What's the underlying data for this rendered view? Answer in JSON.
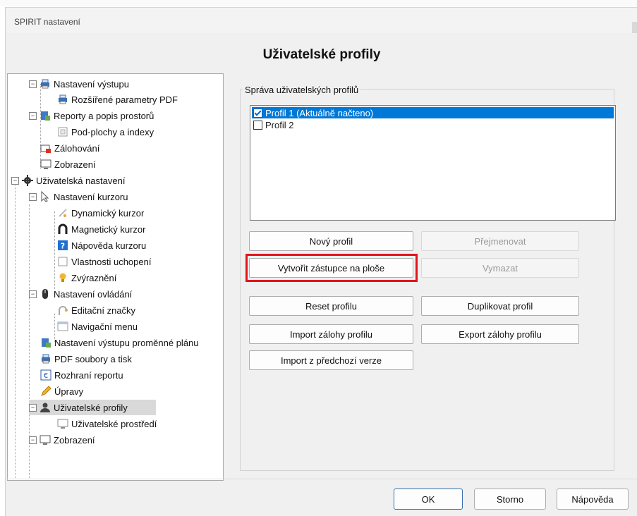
{
  "window": {
    "title": "SPIRIT nastavení",
    "page_title": "Uživatelské profily"
  },
  "tree": [
    {
      "label": "Nastavení výstupu",
      "icon": "printer-icon",
      "expander": "⊟"
    },
    {
      "label": "Rozšířené parametry PDF",
      "icon": "printer-icon"
    },
    {
      "label": "Reporty a popis prostorů",
      "icon": "report-icon",
      "expander": "⊟"
    },
    {
      "label": "Pod-plochy a indexy",
      "icon": "subarea-icon"
    },
    {
      "label": "Zálohování",
      "icon": "backup-icon"
    },
    {
      "label": "Zobrazení",
      "icon": "monitor-icon"
    },
    {
      "label": "Uživatelská nastavení",
      "icon": "gear-icon",
      "expander": "⊟"
    },
    {
      "label": "Nastavení kurzoru",
      "icon": "cursor-icon",
      "expander": "⊟"
    },
    {
      "label": "Dynamický kurzor",
      "icon": "dynamic-cursor-icon"
    },
    {
      "label": "Magnetický kurzor",
      "icon": "magnet-icon"
    },
    {
      "label": "Nápověda kurzoru",
      "icon": "help-icon"
    },
    {
      "label": "Vlastnosti uchopení",
      "icon": "snap-icon"
    },
    {
      "label": "Zvýraznění",
      "icon": "bulb-icon"
    },
    {
      "label": "Nastavení ovládání",
      "icon": "mouse-icon",
      "expander": "⊟"
    },
    {
      "label": "Editační značky",
      "icon": "edit-mark-icon"
    },
    {
      "label": "Navigační menu",
      "icon": "menu-icon"
    },
    {
      "label": "Nastavení výstupu proměnné plánu",
      "icon": "report-icon"
    },
    {
      "label": "PDF soubory a tisk",
      "icon": "printer-icon"
    },
    {
      "label": "Rozhraní reportu",
      "icon": "report-interface-icon"
    },
    {
      "label": "Úpravy",
      "icon": "pencil-icon"
    },
    {
      "label": "Uživatelské profily",
      "icon": "user-icon",
      "expander": "⊟"
    },
    {
      "label": "Uživatelské prostředí",
      "icon": "environment-icon"
    },
    {
      "label": "Zobrazení",
      "icon": "monitor-icon",
      "expander": "⊟"
    }
  ],
  "profiles": {
    "group_title": "Správa uživatelských profilů",
    "items": [
      {
        "label": "Profil 1 (Aktuálně načteno)",
        "checked": true,
        "selected": true
      },
      {
        "label": "Profil 2",
        "checked": false,
        "selected": false
      }
    ]
  },
  "buttons": {
    "new_profile": "Nový profil",
    "rename": "Přejmenovat",
    "create_shortcut": "Vytvořit zástupce na ploše",
    "delete": "Vymazat",
    "reset": "Reset profilu",
    "duplicate": "Duplikovat profil",
    "import_backup": "Import zálohy profilu",
    "export_backup": "Export zálohy profilu",
    "import_previous": "Import z předchozí verze"
  },
  "footer": {
    "ok": "OK",
    "cancel": "Storno",
    "help": "Nápověda"
  },
  "colors": {
    "selection": "#0078d7",
    "highlight_box": "#e2141c",
    "tree_selected": "#d9d9d9"
  }
}
